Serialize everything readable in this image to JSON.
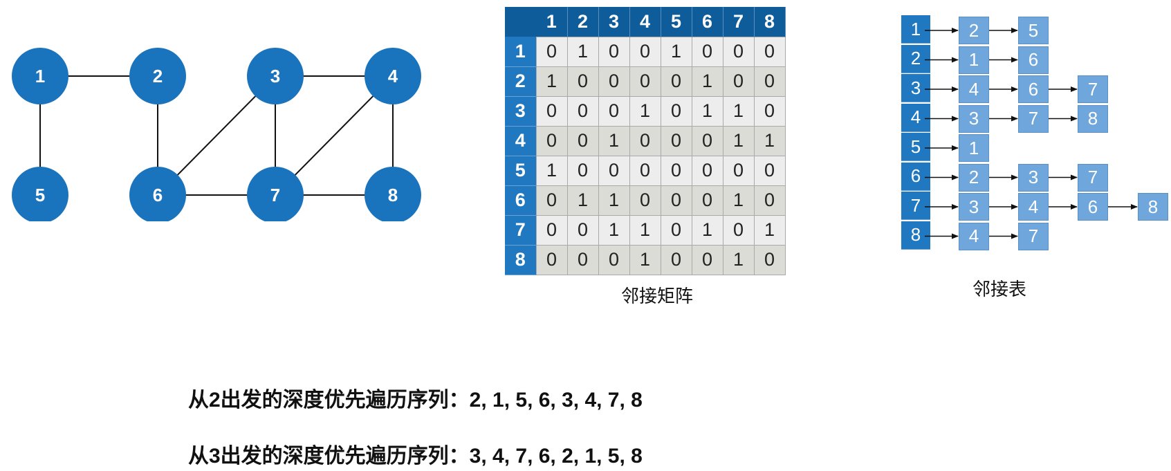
{
  "graph": {
    "nodes": [
      "1",
      "2",
      "3",
      "4",
      "5",
      "6",
      "7",
      "8"
    ],
    "edges": [
      [
        "1",
        "2"
      ],
      [
        "1",
        "5"
      ],
      [
        "2",
        "6"
      ],
      [
        "3",
        "4"
      ],
      [
        "3",
        "6"
      ],
      [
        "3",
        "7"
      ],
      [
        "4",
        "7"
      ],
      [
        "4",
        "8"
      ],
      [
        "6",
        "7"
      ],
      [
        "7",
        "8"
      ]
    ]
  },
  "matrix": {
    "caption": "邻接矩阵",
    "headers": [
      "1",
      "2",
      "3",
      "4",
      "5",
      "6",
      "7",
      "8"
    ],
    "rows": [
      [
        "0",
        "1",
        "0",
        "0",
        "1",
        "0",
        "0",
        "0"
      ],
      [
        "1",
        "0",
        "0",
        "0",
        "0",
        "1",
        "0",
        "0"
      ],
      [
        "0",
        "0",
        "0",
        "1",
        "0",
        "1",
        "1",
        "0"
      ],
      [
        "0",
        "0",
        "1",
        "0",
        "0",
        "0",
        "1",
        "1"
      ],
      [
        "1",
        "0",
        "0",
        "0",
        "0",
        "0",
        "0",
        "0"
      ],
      [
        "0",
        "1",
        "1",
        "0",
        "0",
        "0",
        "1",
        "0"
      ],
      [
        "0",
        "0",
        "1",
        "1",
        "0",
        "1",
        "0",
        "1"
      ],
      [
        "0",
        "0",
        "0",
        "1",
        "0",
        "0",
        "1",
        "0"
      ]
    ]
  },
  "adj_list": {
    "caption": "邻接表",
    "heads": [
      "1",
      "2",
      "3",
      "4",
      "5",
      "6",
      "7",
      "8"
    ],
    "lists": [
      [
        "2",
        "5"
      ],
      [
        "1",
        "6"
      ],
      [
        "4",
        "6",
        "7"
      ],
      [
        "3",
        "7",
        "8"
      ],
      [
        "1"
      ],
      [
        "2",
        "3",
        "7"
      ],
      [
        "3",
        "4",
        "6",
        "8"
      ],
      [
        "4",
        "7"
      ]
    ]
  },
  "sequences": {
    "from2": "从2出发的深度优先遍历序列：2, 1, 5, 6, 3, 4, 7, 8",
    "from3": "从3出发的深度优先遍历序列：3, 4, 7, 6, 2, 1, 5, 8"
  },
  "colors": {
    "node_fill": "#1a73bd",
    "header_dark": "#0f5c9a",
    "header_mid": "#1f78c0",
    "list_box": "#6fa6dc"
  }
}
